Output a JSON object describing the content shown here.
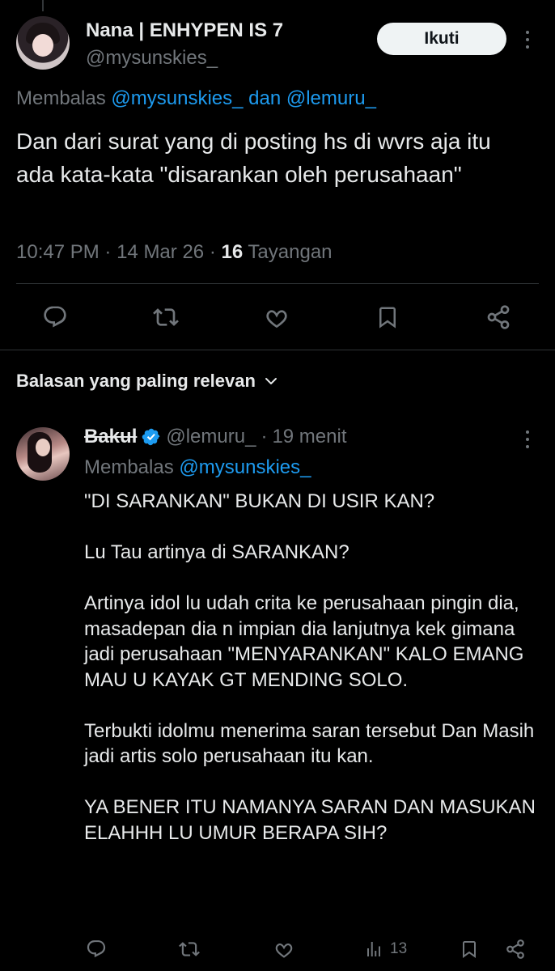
{
  "main_tweet": {
    "display_name": "Nana | ENHYPEN IS 7",
    "handle": "@mysunskies_",
    "follow_label": "Ikuti",
    "reply_prefix": "Membalas",
    "reply_mention_1": "@mysunskies_",
    "reply_conjunction": "dan",
    "reply_mention_2": "@lemuru_",
    "text": "Dan dari surat yang di posting hs di wvrs aja itu ada kata-kata \"disarankan oleh perusahaan\"",
    "time": "10:47 PM",
    "separator": "·",
    "date": "14 Mar 26",
    "views_count": "16",
    "views_label": "Tayangan"
  },
  "sort": {
    "label": "Balasan yang paling relevan"
  },
  "reply": {
    "display_name": "Bakul",
    "verified": true,
    "handle": "@lemuru_",
    "separator": "·",
    "time_ago": "19 menit",
    "reply_prefix": "Membalas",
    "reply_mention": "@mysunskies_",
    "paragraphs": [
      "\"DI SARANKAN\" BUKAN DI USIR KAN?",
      "Lu Tau artinya di SARANKAN?",
      "Artinya idol lu udah crita ke perusahaan pingin dia, masadepan dia  n impian dia lanjutnya  kek gimana jadi perusahaan \"MENYARANKAN\" KALO EMANG MAU U KAYAK GT MENDING SOLO.",
      "Terbukti idolmu menerima saran tersebut Dan Masih jadi artis solo perusahaan itu kan.",
      "YA BENER ITU NAMANYA SARAN DAN MASUKAN ELAHHH LU UMUR BERAPA SIH?"
    ],
    "views_count": "13"
  },
  "icons": {
    "reply": "reply-icon",
    "retweet": "retweet-icon",
    "like": "heart-icon",
    "bookmark": "bookmark-icon",
    "share": "share-icon",
    "views": "views-icon",
    "more": "more-icon",
    "verified": "verified-badge-icon",
    "chevron": "chevron-down-icon"
  },
  "colors": {
    "background": "#000000",
    "text": "#e7e9ea",
    "muted": "#71767b",
    "accent": "#1d9bf0",
    "divider": "#2f3336"
  }
}
